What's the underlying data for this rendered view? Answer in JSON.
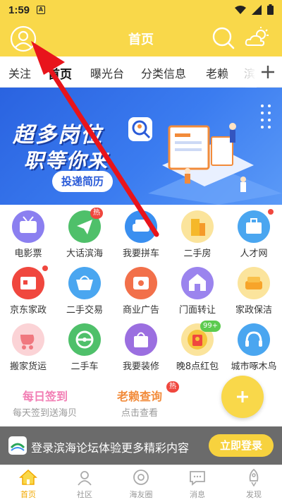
{
  "status_bar": {
    "time": "1:59",
    "notif": "A"
  },
  "header": {
    "title": "首页"
  },
  "tabs": [
    {
      "label": "关注"
    },
    {
      "label": "首页"
    },
    {
      "label": "曝光台"
    },
    {
      "label": "分类信息"
    },
    {
      "label": "老赖"
    },
    {
      "label": "滨"
    }
  ],
  "banner": {
    "line1": "超多岗位",
    "line2": "职等你来",
    "button": "投递简历"
  },
  "grid": [
    {
      "label": "电影票",
      "color": "#8b7ff0",
      "icon": "tv-icon"
    },
    {
      "label": "大话滨海",
      "color": "#4fc06a",
      "icon": "paper-plane-icon",
      "badge": "热"
    },
    {
      "label": "我要拼车",
      "color": "#3a8ff0",
      "icon": "car-icon"
    },
    {
      "label": "二手房",
      "color": "#f5c53c",
      "icon": "building-icon"
    },
    {
      "label": "人才网",
      "color": "#4aa6f0",
      "icon": "briefcase-icon",
      "dot": true
    },
    {
      "label": "京东家政",
      "color": "#f0473e",
      "icon": "shop-icon",
      "dot": true
    },
    {
      "label": "二手交易",
      "color": "#4aa6f0",
      "icon": "basket-icon"
    },
    {
      "label": "商业广告",
      "color": "#f2704a",
      "icon": "ad-icon"
    },
    {
      "label": "门面转让",
      "color": "#9b84ee",
      "icon": "storefront-icon"
    },
    {
      "label": "家政保洁",
      "color": "#f7b93a",
      "icon": "sofa-icon"
    },
    {
      "label": "搬家货运",
      "color": "#f3a6ad",
      "icon": "stroller-icon"
    },
    {
      "label": "二手车",
      "color": "#4fc06a",
      "icon": "steering-wheel-icon"
    },
    {
      "label": "我要装修",
      "color": "#9b6fe0",
      "icon": "bag-icon"
    },
    {
      "label": "晚8点红包",
      "color": "#f5c53c",
      "icon": "red-packet-icon",
      "badge_green": "99+"
    },
    {
      "label": "城市啄木鸟",
      "color": "#4aa6f0",
      "icon": "headset-icon"
    }
  ],
  "quick": [
    {
      "title": "每日签到",
      "sub": "每天签到送海贝",
      "color": "#f27eb4"
    },
    {
      "title": "老赖查询",
      "sub": "点击查看",
      "color": "#f28b3a",
      "badge": "热"
    }
  ],
  "promo": {
    "text": "登录滨海论坛体验更多精彩内容",
    "button": "立即登录"
  },
  "bottom_nav": [
    {
      "label": "首页",
      "active": true
    },
    {
      "label": "社区"
    },
    {
      "label": "海友圈"
    },
    {
      "label": "消息"
    },
    {
      "label": "发现"
    }
  ],
  "colors": {
    "accent": "#f9d84a",
    "arrow": "#e8141b",
    "banner": "#2a63e0"
  }
}
